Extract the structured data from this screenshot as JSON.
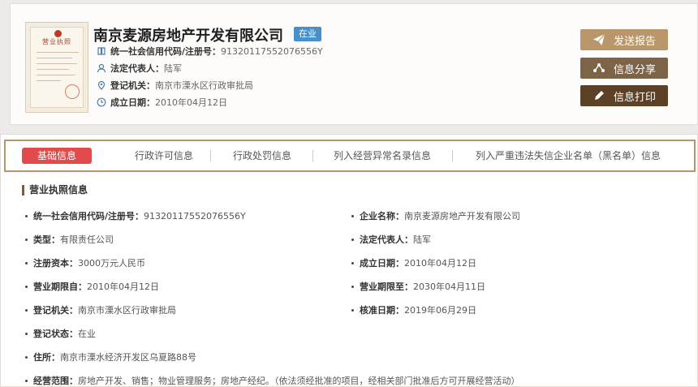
{
  "license": {
    "title": "营业执照"
  },
  "company": {
    "name": "南京麦源房地产开发有限公司",
    "status": "在业"
  },
  "summary": [
    {
      "icon": "credit-code-icon",
      "label": "统一社会信用代码/注册号：",
      "value": "91320117552076556Y"
    },
    {
      "icon": "person-icon",
      "label": "法定代表人：",
      "value": "陆军"
    },
    {
      "icon": "location-icon",
      "label": "登记机关：",
      "value": "南京市溧水区行政审批局"
    },
    {
      "icon": "clock-icon",
      "label": "成立日期：",
      "value": "2010年04月12日"
    }
  ],
  "actions": {
    "report": "发送报告",
    "share": "信息分享",
    "print": "信息打印"
  },
  "tabs": [
    {
      "label": "基础信息",
      "active": true
    },
    {
      "label": "行政许可信息",
      "active": false
    },
    {
      "label": "行政处罚信息",
      "active": false
    },
    {
      "label": "列入经营异常名录信息",
      "active": false
    },
    {
      "label": "列入严重违法失信企业名单（黑名单）信息",
      "active": false
    }
  ],
  "section": {
    "title": "营业执照信息",
    "fields_left": [
      {
        "label": "统一社会信用代码/注册号：",
        "value": "91320117552076556Y"
      },
      {
        "label": "类型：",
        "value": "有限责任公司"
      },
      {
        "label": "注册资本：",
        "value": "3000万元人民币"
      },
      {
        "label": "营业期限自：",
        "value": "2010年04月12日"
      },
      {
        "label": "登记机关：",
        "value": "南京市溧水区行政审批局"
      },
      {
        "label": "登记状态：",
        "value": "在业"
      },
      {
        "label": "住所：",
        "value": "南京市溧水经济开发区乌夏路88号"
      },
      {
        "label": "经营范围：",
        "value": "房地产开发、销售；物业管理服务；房地产经纪。（依法须经批准的项目，经相关部门批准后方可开展经营活动）"
      }
    ],
    "fields_right": [
      {
        "label": "企业名称：",
        "value": "南京麦源房地产开发有限公司"
      },
      {
        "label": "法定代表人：",
        "value": "陆军"
      },
      {
        "label": "成立日期：",
        "value": "2010年04月12日"
      },
      {
        "label": "营业期限至：",
        "value": "2030年04月11日"
      },
      {
        "label": "核准日期：",
        "value": "2019年06月29日"
      }
    ]
  },
  "colors": {
    "badge": "#4a90c8",
    "report_btn": "#b9976a",
    "share_btn": "#7d6446",
    "print_btn": "#5c4126",
    "active_tab": "#e24b4b",
    "tab_border": "#b8956a"
  }
}
